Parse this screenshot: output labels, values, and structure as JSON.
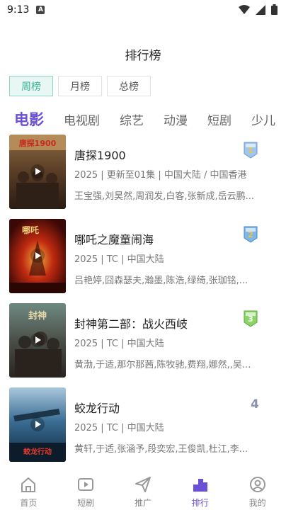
{
  "status": {
    "time": "9:13",
    "notif_letter": "A"
  },
  "header": {
    "title": "排行榜"
  },
  "period_tabs": [
    {
      "label": "周榜",
      "active": true
    },
    {
      "label": "月榜",
      "active": false
    },
    {
      "label": "总榜",
      "active": false
    }
  ],
  "category_tabs": [
    {
      "label": "电影",
      "active": true
    },
    {
      "label": "电视剧"
    },
    {
      "label": "综艺"
    },
    {
      "label": "动漫"
    },
    {
      "label": "短剧"
    },
    {
      "label": "少儿"
    }
  ],
  "items": [
    {
      "title": "唐探1900",
      "meta": "2025 | 更新至01集 | 中国大陆 / 中国香港",
      "cast": "王宝强,刘昊然,周润发,白客,张新成,岳云鹏...",
      "rank": "1",
      "poster_text": "唐探1900"
    },
    {
      "title": "哪吒之魔童闹海",
      "meta": "2025 | TC | 中国大陆",
      "cast": "吕艳婷,囧森瑟夫,瀚墨,陈浩,绿绮,张珈铭,...",
      "rank": "2",
      "poster_text": "哪吒"
    },
    {
      "title": "封神第二部：战火西岐",
      "meta": "2025 | TC | 中国大陆",
      "cast": "黄渤,于适,那尔那茜,陈牧驰,费翔,娜然,,吴...",
      "rank": "3",
      "poster_text": "封神"
    },
    {
      "title": "蛟龙行动",
      "meta": "2025 | TC | 中国大陆",
      "cast": "黄轩,于适,张涵予,段奕宏,王俊凯,杜江,李...",
      "rank": "4",
      "poster_text": "蛟龙行动"
    }
  ],
  "bottom_nav": [
    {
      "label": "首页",
      "icon": "home-icon"
    },
    {
      "label": "短剧",
      "icon": "video-icon"
    },
    {
      "label": "推广",
      "icon": "send-icon"
    },
    {
      "label": "排行",
      "icon": "rank-icon",
      "active": true
    },
    {
      "label": "我的",
      "icon": "profile-icon"
    }
  ],
  "colors": {
    "accent": "#6a4fd7",
    "tab_active_bg": "#e9f7f4",
    "tab_active_text": "#38b394"
  }
}
